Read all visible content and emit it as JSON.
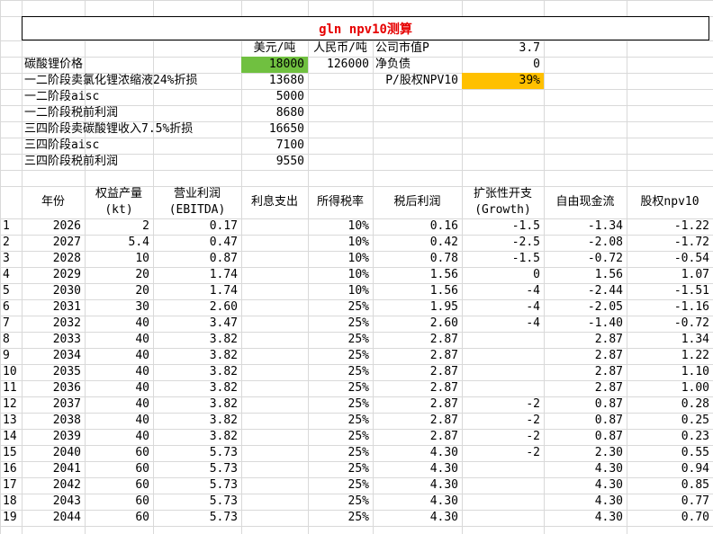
{
  "title": "gln npv10测算",
  "summary": {
    "usd_header": "美元/吨",
    "rmb_header": "人民币/吨",
    "rows": [
      {
        "label": "碳酸锂价格",
        "usd": "18000",
        "rmb": "126000"
      },
      {
        "label": "一二阶段卖氯化锂浓缩液24%折损",
        "usd": "13680"
      },
      {
        "label": "一二阶段aisc",
        "usd": "5000"
      },
      {
        "label": "一二阶段税前利润",
        "usd": "8680"
      },
      {
        "label": "三四阶段卖碳酸锂收入7.5%折损",
        "usd": "16650"
      },
      {
        "label": "三四阶段aisc",
        "usd": "7100"
      },
      {
        "label": "三四阶段税前利润",
        "usd": "9550"
      }
    ]
  },
  "valuation": {
    "market_cap_label": "公司市值P",
    "market_cap": "3.7",
    "net_debt_label": "净负债",
    "net_debt": "0",
    "ratio_label": "P/股权NPV10",
    "ratio": "39%"
  },
  "colors": {
    "green_cell": "#70c040",
    "orange_cell": "#ffc000",
    "title_text": "#e60000"
  },
  "table": {
    "headers": [
      {
        "line1": "年份",
        "line2": ""
      },
      {
        "line1": "权益产量",
        "line2": "(kt)"
      },
      {
        "line1": "营业利润",
        "line2": "(EBITDA)"
      },
      {
        "line1": "利息支出",
        "line2": ""
      },
      {
        "line1": "所得税率",
        "line2": ""
      },
      {
        "line1": "税后利润",
        "line2": ""
      },
      {
        "line1": "扩张性开支",
        "line2": "(Growth)"
      },
      {
        "line1": "自由现金流",
        "line2": ""
      },
      {
        "line1": "股权npv10",
        "line2": ""
      }
    ],
    "rows": [
      [
        "1",
        "2026",
        "2",
        "0.17",
        "",
        "10%",
        "0.16",
        "-1.5",
        "-1.34",
        "-1.22"
      ],
      [
        "2",
        "2027",
        "5.4",
        "0.47",
        "",
        "10%",
        "0.42",
        "-2.5",
        "-2.08",
        "-1.72"
      ],
      [
        "3",
        "2028",
        "10",
        "0.87",
        "",
        "10%",
        "0.78",
        "-1.5",
        "-0.72",
        "-0.54"
      ],
      [
        "4",
        "2029",
        "20",
        "1.74",
        "",
        "10%",
        "1.56",
        "0",
        "1.56",
        "1.07"
      ],
      [
        "5",
        "2030",
        "20",
        "1.74",
        "",
        "10%",
        "1.56",
        "-4",
        "-2.44",
        "-1.51"
      ],
      [
        "6",
        "2031",
        "30",
        "2.60",
        "",
        "25%",
        "1.95",
        "-4",
        "-2.05",
        "-1.16"
      ],
      [
        "7",
        "2032",
        "40",
        "3.47",
        "",
        "25%",
        "2.60",
        "-4",
        "-1.40",
        "-0.72"
      ],
      [
        "8",
        "2033",
        "40",
        "3.82",
        "",
        "25%",
        "2.87",
        "",
        "2.87",
        "1.34"
      ],
      [
        "9",
        "2034",
        "40",
        "3.82",
        "",
        "25%",
        "2.87",
        "",
        "2.87",
        "1.22"
      ],
      [
        "10",
        "2035",
        "40",
        "3.82",
        "",
        "25%",
        "2.87",
        "",
        "2.87",
        "1.10"
      ],
      [
        "11",
        "2036",
        "40",
        "3.82",
        "",
        "25%",
        "2.87",
        "",
        "2.87",
        "1.00"
      ],
      [
        "12",
        "2037",
        "40",
        "3.82",
        "",
        "25%",
        "2.87",
        "-2",
        "0.87",
        "0.28"
      ],
      [
        "13",
        "2038",
        "40",
        "3.82",
        "",
        "25%",
        "2.87",
        "-2",
        "0.87",
        "0.25"
      ],
      [
        "14",
        "2039",
        "40",
        "3.82",
        "",
        "25%",
        "2.87",
        "-2",
        "0.87",
        "0.23"
      ],
      [
        "15",
        "2040",
        "60",
        "5.73",
        "",
        "25%",
        "4.30",
        "-2",
        "2.30",
        "0.55"
      ],
      [
        "16",
        "2041",
        "60",
        "5.73",
        "",
        "25%",
        "4.30",
        "",
        "4.30",
        "0.94"
      ],
      [
        "17",
        "2042",
        "60",
        "5.73",
        "",
        "25%",
        "4.30",
        "",
        "4.30",
        "0.85"
      ],
      [
        "18",
        "2043",
        "60",
        "5.73",
        "",
        "25%",
        "4.30",
        "",
        "4.30",
        "0.77"
      ],
      [
        "19",
        "2044",
        "60",
        "5.73",
        "",
        "25%",
        "4.30",
        "",
        "4.30",
        "0.70"
      ]
    ]
  }
}
